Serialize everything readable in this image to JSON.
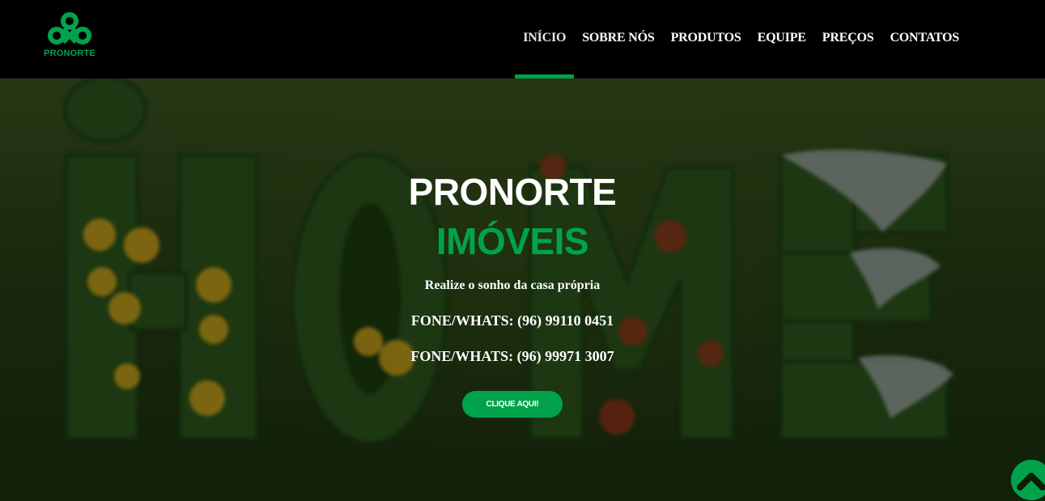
{
  "brand": {
    "name": "PRONORTE",
    "accent_color": "#00a34c",
    "logo_icon": "pronorte-logo-icon"
  },
  "nav": {
    "items": [
      {
        "label": "INÍCIO",
        "active": true
      },
      {
        "label": "SOBRE NÓS"
      },
      {
        "label": "PRODUTOS"
      },
      {
        "label": "EQUIPE"
      },
      {
        "label": "PREÇOS"
      },
      {
        "label": "CONTATOS"
      }
    ]
  },
  "hero": {
    "title_line1": "PRONORTE",
    "title_line2": "IMÓVEIS",
    "tagline": "Realize o sonho da casa própria",
    "phone1": "FONE/WHATS: (96) 99110 0451",
    "phone2": "FONE/WHATS: (96) 99971 3007",
    "cta_label": "CLIQUE AQUI!",
    "background_image": "grass-letters-home"
  },
  "back_to_top": {
    "icon": "chevron-up-icon"
  }
}
